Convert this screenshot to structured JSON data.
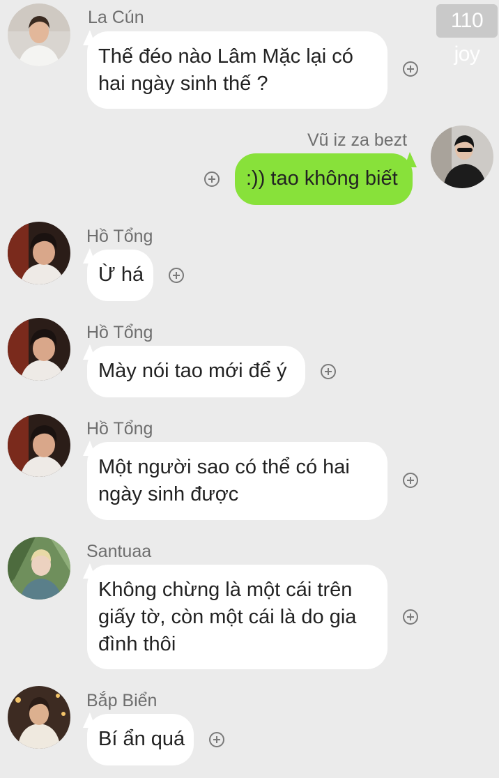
{
  "watermark": "110 joy",
  "messages": [
    {
      "sender": "La Cún",
      "avatar_icon": "avatar-la-cun",
      "lines": [
        "Thế đéo nào Lâm Mặc lại có",
        "hai ngày sinh thế ?"
      ]
    },
    {
      "sender": "Vũ iz za bezt",
      "avatar_icon": "avatar-vu",
      "lines": [
        ":)) tao không biết"
      ],
      "outgoing": true
    },
    {
      "sender": "Hồ Tổng",
      "avatar_icon": "avatar-ho-tong",
      "lines": [
        "Ừ há"
      ]
    },
    {
      "sender": "Hồ Tổng",
      "avatar_icon": "avatar-ho-tong",
      "lines": [
        "Mày nói tao mới để ý"
      ]
    },
    {
      "sender": "Hồ Tổng",
      "avatar_icon": "avatar-ho-tong",
      "lines": [
        "Một người sao có thể có hai",
        "ngày sinh được"
      ]
    },
    {
      "sender": "Santuaa",
      "avatar_icon": "avatar-santuaa",
      "lines": [
        "Không chừng là một cái trên",
        "giấy tờ, còn một cái là do gia",
        "đình thôi"
      ]
    },
    {
      "sender": "Bắp Biển",
      "avatar_icon": "avatar-bap-bien",
      "lines": [
        "Bí ẩn quá"
      ]
    }
  ],
  "colors": {
    "background": "#ebebeb",
    "outgoing_bubble": "#88e13a",
    "incoming_bubble": "#ffffff"
  }
}
